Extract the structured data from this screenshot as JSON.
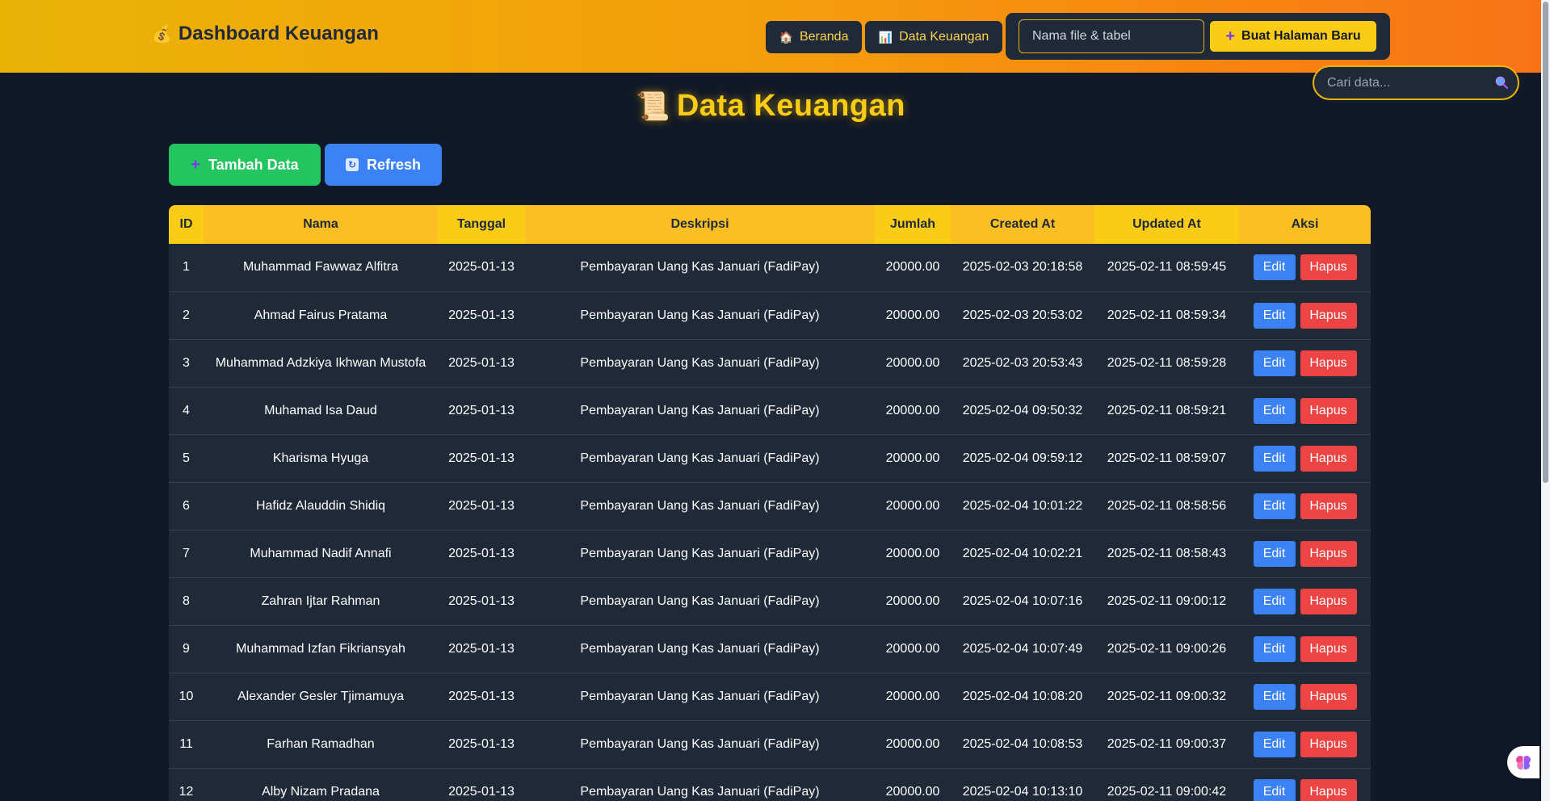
{
  "header": {
    "brand_icon": "money-bag-icon",
    "brand": "Dashboard Keuangan",
    "nav": [
      {
        "label": "Beranda",
        "icon": "house-icon"
      },
      {
        "label": "Data Keuangan",
        "icon": "chart-icon"
      }
    ],
    "create_input_placeholder": "Nama file & tabel",
    "create_button_label": "Buat Halaman Baru"
  },
  "search": {
    "placeholder": "Cari data...",
    "icon": "search-icon"
  },
  "page_title": "Data Keuangan",
  "actions": {
    "add_label": "Tambah Data",
    "refresh_label": "Refresh"
  },
  "colors": {
    "header_gradient_start": "#eab308",
    "header_gradient_end": "#f97316",
    "background": "#111827",
    "accent_yellow": "#facc15",
    "add_green": "#22c55e",
    "edit_blue": "#3b82f6",
    "delete_red": "#ef4444"
  },
  "table": {
    "columns": [
      "ID",
      "Nama",
      "Tanggal",
      "Deskripsi",
      "Jumlah",
      "Created At",
      "Updated At",
      "Aksi"
    ],
    "edit_label": "Edit",
    "delete_label": "Hapus",
    "rows": [
      [
        "1",
        "Muhammad Fawwaz Alfitra",
        "2025-01-13",
        "Pembayaran Uang Kas Januari (FadiPay)",
        "20000.00",
        "2025-02-03 20:18:58",
        "2025-02-11 08:59:45"
      ],
      [
        "2",
        "Ahmad Fairus Pratama",
        "2025-01-13",
        "Pembayaran Uang Kas Januari (FadiPay)",
        "20000.00",
        "2025-02-03 20:53:02",
        "2025-02-11 08:59:34"
      ],
      [
        "3",
        "Muhammad Adzkiya Ikhwan Mustofa",
        "2025-01-13",
        "Pembayaran Uang Kas Januari (FadiPay)",
        "20000.00",
        "2025-02-03 20:53:43",
        "2025-02-11 08:59:28"
      ],
      [
        "4",
        "Muhamad Isa Daud",
        "2025-01-13",
        "Pembayaran Uang Kas Januari (FadiPay)",
        "20000.00",
        "2025-02-04 09:50:32",
        "2025-02-11 08:59:21"
      ],
      [
        "5",
        "Kharisma Hyuga",
        "2025-01-13",
        "Pembayaran Uang Kas Januari (FadiPay)",
        "20000.00",
        "2025-02-04 09:59:12",
        "2025-02-11 08:59:07"
      ],
      [
        "6",
        "Hafidz Alauddin Shidiq",
        "2025-01-13",
        "Pembayaran Uang Kas Januari (FadiPay)",
        "20000.00",
        "2025-02-04 10:01:22",
        "2025-02-11 08:58:56"
      ],
      [
        "7",
        "Muhammad Nadif Annafi",
        "2025-01-13",
        "Pembayaran Uang Kas Januari (FadiPay)",
        "20000.00",
        "2025-02-04 10:02:21",
        "2025-02-11 08:58:43"
      ],
      [
        "8",
        "Zahran Ijtar Rahman",
        "2025-01-13",
        "Pembayaran Uang Kas Januari (FadiPay)",
        "20000.00",
        "2025-02-04 10:07:16",
        "2025-02-11 09:00:12"
      ],
      [
        "9",
        "Muhammad Izfan Fikriansyah",
        "2025-01-13",
        "Pembayaran Uang Kas Januari (FadiPay)",
        "20000.00",
        "2025-02-04 10:07:49",
        "2025-02-11 09:00:26"
      ],
      [
        "10",
        "Alexander Gesler Tjimamuya",
        "2025-01-13",
        "Pembayaran Uang Kas Januari (FadiPay)",
        "20000.00",
        "2025-02-04 10:08:20",
        "2025-02-11 09:00:32"
      ],
      [
        "11",
        "Farhan Ramadhan",
        "2025-01-13",
        "Pembayaran Uang Kas Januari (FadiPay)",
        "20000.00",
        "2025-02-04 10:08:53",
        "2025-02-11 09:00:37"
      ],
      [
        "12",
        "Alby Nizam Pradana",
        "2025-01-13",
        "Pembayaran Uang Kas Januari (FadiPay)",
        "20000.00",
        "2025-02-04 10:13:10",
        "2025-02-11 09:00:42"
      ]
    ]
  }
}
